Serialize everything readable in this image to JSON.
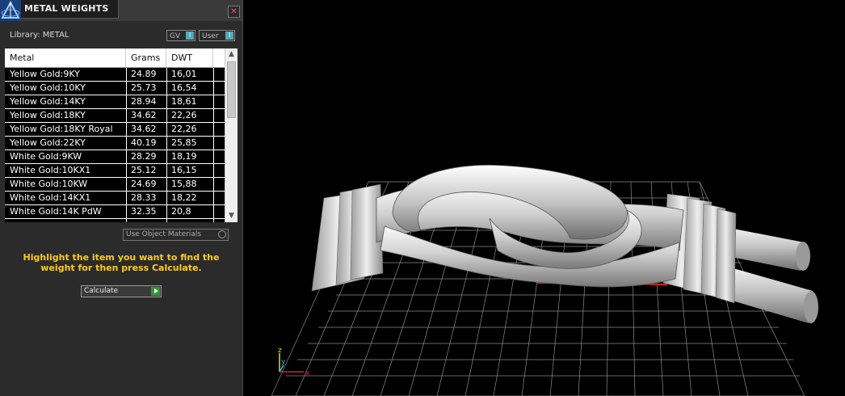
{
  "panel": {
    "title": "METAL WEIGHTS",
    "close_glyph": "✕",
    "library_label": "Library: METAL",
    "toggles": {
      "gv_label": "GV",
      "user_label": "User",
      "knob_glyph": "I"
    },
    "table": {
      "headers": [
        "Metal",
        "Grams",
        "DWT"
      ],
      "rows": [
        {
          "metal": "Yellow Gold:9KY",
          "grams": "24.89",
          "dwt": "16,01"
        },
        {
          "metal": "Yellow Gold:10KY",
          "grams": "25.73",
          "dwt": "16,54"
        },
        {
          "metal": "Yellow Gold:14KY",
          "grams": "28.94",
          "dwt": "18,61"
        },
        {
          "metal": "Yellow Gold:18KY",
          "grams": "34.62",
          "dwt": "22,26"
        },
        {
          "metal": "Yellow Gold:18KY Royal",
          "grams": "34.62",
          "dwt": "22,26"
        },
        {
          "metal": "Yellow Gold:22KY",
          "grams": "40.19",
          "dwt": "25,85"
        },
        {
          "metal": "White Gold:9KW",
          "grams": "28.29",
          "dwt": "18,19"
        },
        {
          "metal": "White Gold:10KX1",
          "grams": "25.12",
          "dwt": "16,15"
        },
        {
          "metal": "White Gold:10KW",
          "grams": "24.69",
          "dwt": "15,88"
        },
        {
          "metal": "White Gold:14KX1",
          "grams": "28.33",
          "dwt": "18,22"
        },
        {
          "metal": "White Gold:14K PdW",
          "grams": "32.35",
          "dwt": "20,8"
        }
      ]
    },
    "use_object_materials_label": "Use Object Materials",
    "hint": "Highlight the item you want to find the weight for then press Calculate.",
    "calculate_label": "Calculate"
  },
  "viewport": {
    "axis_labels": {
      "x": "x",
      "y": "y",
      "z": "z"
    }
  },
  "colors": {
    "accent_yellow": "#ffcc1a",
    "toggle_knob": "#4fa9b8",
    "calculate_arrow": "#2f9a2f",
    "axis_x": "#e02020",
    "axis_z": "#20c0e0"
  },
  "icons": {
    "app_logo": "matrix-triangle-logo-icon",
    "close": "close-icon",
    "scroll_up": "chevron-up-icon",
    "scroll_down": "chevron-down-icon",
    "calculate": "play-arrow-icon"
  }
}
